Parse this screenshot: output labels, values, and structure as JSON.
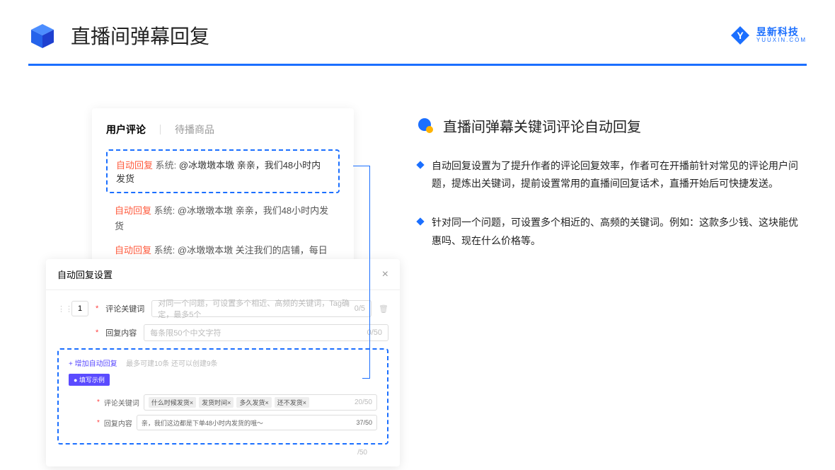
{
  "page_title": "直播间弹幕回复",
  "logo": {
    "cn": "昱新科技",
    "en": "YUUXIN.COM"
  },
  "card1": {
    "tab_active": "用户评论",
    "tab_inactive": "待播商品",
    "msg1": {
      "auto": "自动回复",
      "sys": "系统:",
      "text": "@冰墩墩本墩 亲亲，我们48小时内发货"
    },
    "msg2": {
      "auto": "自动回复",
      "sys": "系统:",
      "text": "@冰墩墩本墩 亲亲，我们48小时内发货"
    },
    "msg3": {
      "auto": "自动回复",
      "sys": "系统:",
      "text": "@冰墩墩本墩 关注我们的店铺，每日都有热门推荐呦～"
    }
  },
  "card2": {
    "title": "自动回复设置",
    "close": "×",
    "row1": {
      "num": "1",
      "label": "评论关键词",
      "placeholder": "对同一个问题，可设置多个相近、高频的关键词，Tag确定，最多5个",
      "counter": "0/5"
    },
    "row2": {
      "label": "回复内容",
      "placeholder": "每条限50个中文字符",
      "counter": "0/50"
    },
    "add": "+ 增加自动回复",
    "add_note": "最多可建10条 还可以创建9条",
    "example_badge": "● 填写示例",
    "ex_row1": {
      "label": "评论关键词",
      "tags": [
        "什么时候发货×",
        "发货时间×",
        "多久发货×",
        "还不发货×"
      ],
      "counter": "20/50"
    },
    "ex_row2": {
      "label": "回复内容",
      "text": "亲，我们这边都是下单48小时内发货的哦～",
      "counter": "37/50"
    },
    "trailing_counter": "/50"
  },
  "right": {
    "section_title": "直播间弹幕关键词评论自动回复",
    "bullet1": "自动回复设置为了提升作者的评论回复效率，作者可在开播前针对常见的评论用户问题，提炼出关键词，提前设置常用的直播间回复话术，直播开始后可快捷发送。",
    "bullet2": "针对同一个问题，可设置多个相近的、高频的关键词。例如：这款多少钱、这块能优惠吗、现在什么价格等。"
  }
}
